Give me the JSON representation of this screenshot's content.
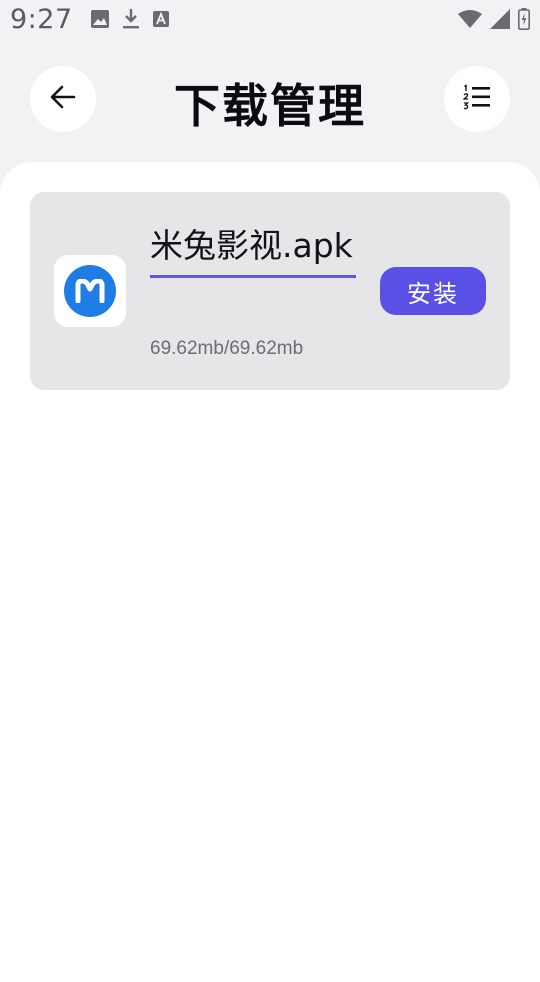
{
  "status_bar": {
    "time": "9:27",
    "left_icons": [
      "image-icon",
      "download-icon",
      "text-a-icon"
    ],
    "right_icons": [
      "wifi-icon",
      "signal-icon",
      "battery-icon"
    ]
  },
  "header": {
    "title": "下载管理",
    "back_icon": "arrow-left-icon",
    "menu_icon": "numbered-list-icon"
  },
  "downloads": [
    {
      "name": "米兔影视.apk",
      "size": "69.62mb/69.62mb",
      "action_label": "安装",
      "icon": "app-logo-m-icon"
    }
  ],
  "colors": {
    "accent": "#5a50e6",
    "underline": "#5b57e0",
    "app_icon_blue": "#1e7de5",
    "card_bg": "#e6e6e8",
    "page_bg": "#f2f2f4"
  }
}
